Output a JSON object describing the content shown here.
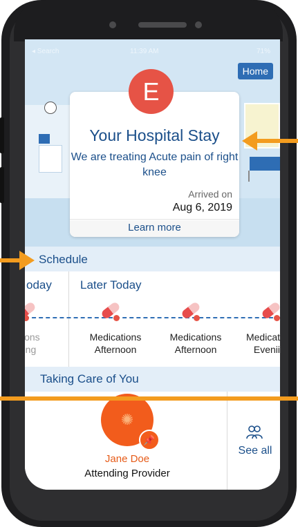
{
  "status_bar": {
    "carrier": "◂ Search",
    "time": "11:39 AM",
    "battery": "71%"
  },
  "header": {
    "home_label": "Home",
    "avatar_letter": "E"
  },
  "stay_card": {
    "title": "Your Hospital Stay",
    "subtitle": "We are treating Acute pain of right knee",
    "arrived_label": "Arrived on",
    "arrived_date": "Aug 6, 2019",
    "learn_more_label": "Learn more"
  },
  "schedule": {
    "title": "Schedule",
    "today_label": "oday",
    "later_label": "Later Today",
    "items": [
      {
        "line1": "ations",
        "line2": "ning"
      },
      {
        "line1": "Medications",
        "line2": "Afternoon"
      },
      {
        "line1": "Medications",
        "line2": "Afternoon"
      },
      {
        "line1": "Medicat",
        "line2": "Evenii"
      }
    ]
  },
  "care": {
    "title": "Taking Care of You",
    "provider_name": "Jane Doe",
    "provider_role": "Attending Provider",
    "see_all_label": "See all"
  },
  "colors": {
    "accent": "#1b4f8a",
    "brand_orange": "#f25c1c",
    "arrow": "#f39c1f",
    "avatar_red": "#e65346"
  },
  "icons": [
    "clock-icon",
    "pill-icon",
    "pin-icon",
    "people-icon",
    "spinner-icon"
  ]
}
